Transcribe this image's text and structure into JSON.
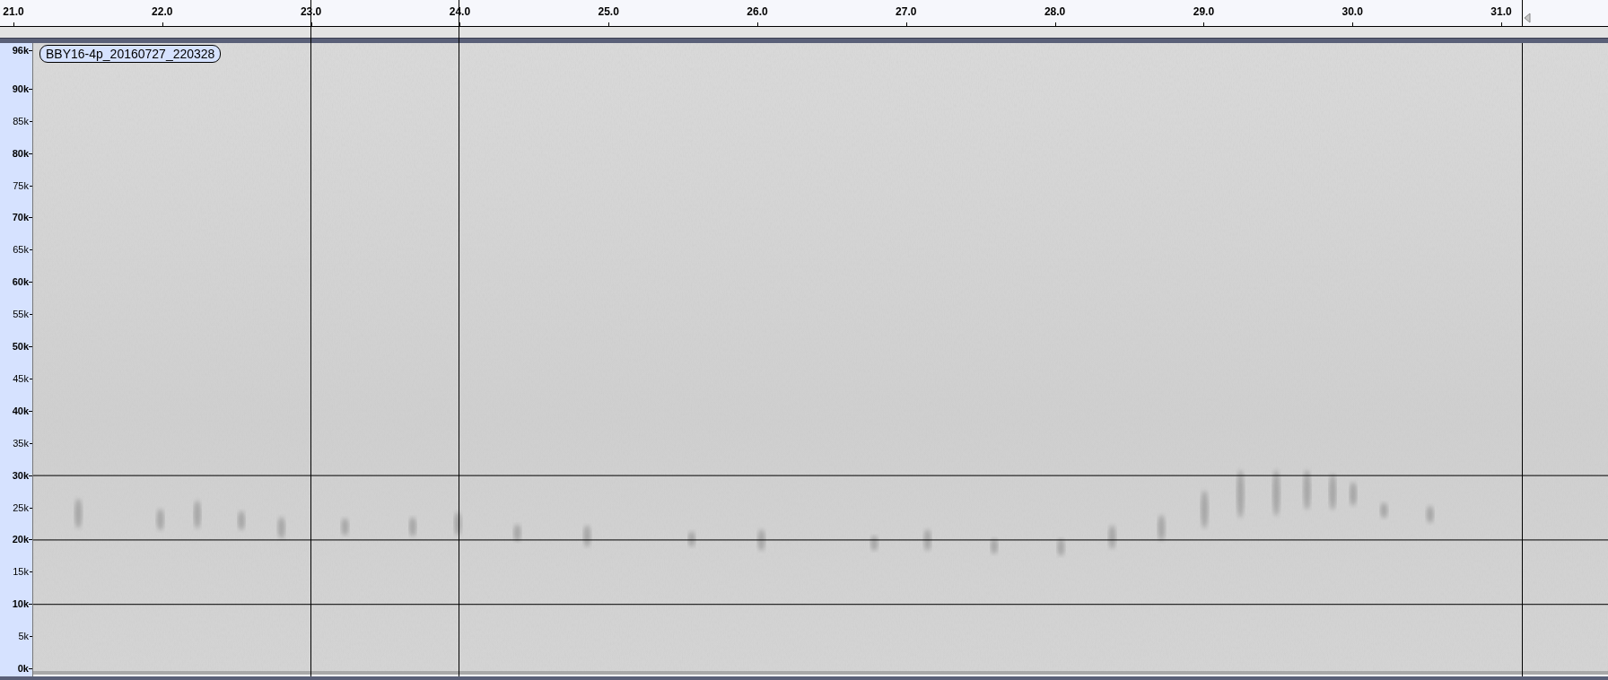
{
  "timeline": {
    "ticks": [
      "21.0",
      "22.0",
      "23.0",
      "24.0",
      "25.0",
      "26.0",
      "27.0",
      "28.0",
      "29.0",
      "30.0",
      "31.0"
    ]
  },
  "track": {
    "name": "BBY16-4p_20160727_220328",
    "frequency_axis": [
      {
        "label": "96k",
        "major": true
      },
      {
        "label": "90k",
        "major": true
      },
      {
        "label": "85k",
        "major": false
      },
      {
        "label": "80k",
        "major": true
      },
      {
        "label": "75k",
        "major": false
      },
      {
        "label": "70k",
        "major": true
      },
      {
        "label": "65k",
        "major": false
      },
      {
        "label": "60k",
        "major": true
      },
      {
        "label": "55k",
        "major": false
      },
      {
        "label": "50k",
        "major": true
      },
      {
        "label": "45k",
        "major": false
      },
      {
        "label": "40k",
        "major": true
      },
      {
        "label": "35k",
        "major": false
      },
      {
        "label": "30k",
        "major": true
      },
      {
        "label": "25k",
        "major": false
      },
      {
        "label": "20k",
        "major": true
      },
      {
        "label": "15k",
        "major": false
      },
      {
        "label": "10k",
        "major": true
      },
      {
        "label": "5k",
        "major": false
      },
      {
        "label": "0k",
        "major": true
      }
    ]
  }
}
